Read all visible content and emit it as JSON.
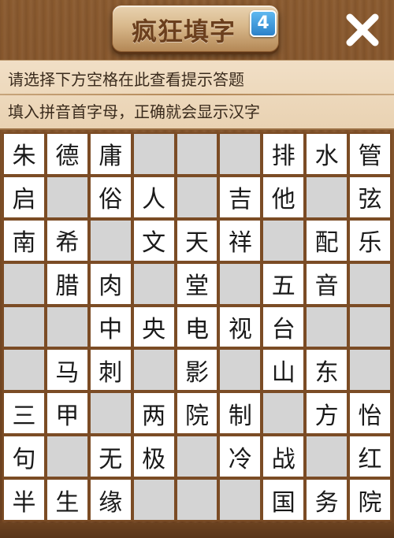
{
  "header": {
    "title": "疯狂填字",
    "level_badge": "4",
    "close_icon": "close-x-icon"
  },
  "hint": {
    "line1": "请选择下方空格在此查看提示答题",
    "line2": "填入拼音首字母，正确就会显示汉字"
  },
  "colors": {
    "wood": "#7b4c25",
    "hint_bg": "#f1dfc6",
    "filled_cell": "#ffffff",
    "blank_cell": "#d4d4d4",
    "badge": "#2c82c9"
  },
  "grid": {
    "rows": [
      [
        "朱",
        "德",
        "庸",
        "#",
        "#",
        "#",
        "排",
        "水",
        "管"
      ],
      [
        "启",
        "#",
        "俗",
        "人",
        "#",
        "吉",
        "他",
        "#",
        "弦"
      ],
      [
        "南",
        "希",
        "#",
        "文",
        "天",
        "祥",
        "#",
        "配",
        "乐"
      ],
      [
        "#",
        "腊",
        "肉",
        "#",
        "堂",
        "#",
        "五",
        "音",
        "#"
      ],
      [
        "#",
        "#",
        "中",
        "央",
        "电",
        "视",
        "台",
        "#",
        "#"
      ],
      [
        "#",
        "马",
        "刺",
        "#",
        "影",
        "#",
        "山",
        "东",
        "#"
      ],
      [
        "三",
        "甲",
        "#",
        "两",
        "院",
        "制",
        "#",
        "方",
        "怡"
      ],
      [
        "句",
        "#",
        "无",
        "极",
        "#",
        "冷",
        "战",
        "#",
        "红"
      ],
      [
        "半",
        "生",
        "缘",
        "#",
        "#",
        "#",
        "国",
        "务",
        "院"
      ]
    ]
  }
}
